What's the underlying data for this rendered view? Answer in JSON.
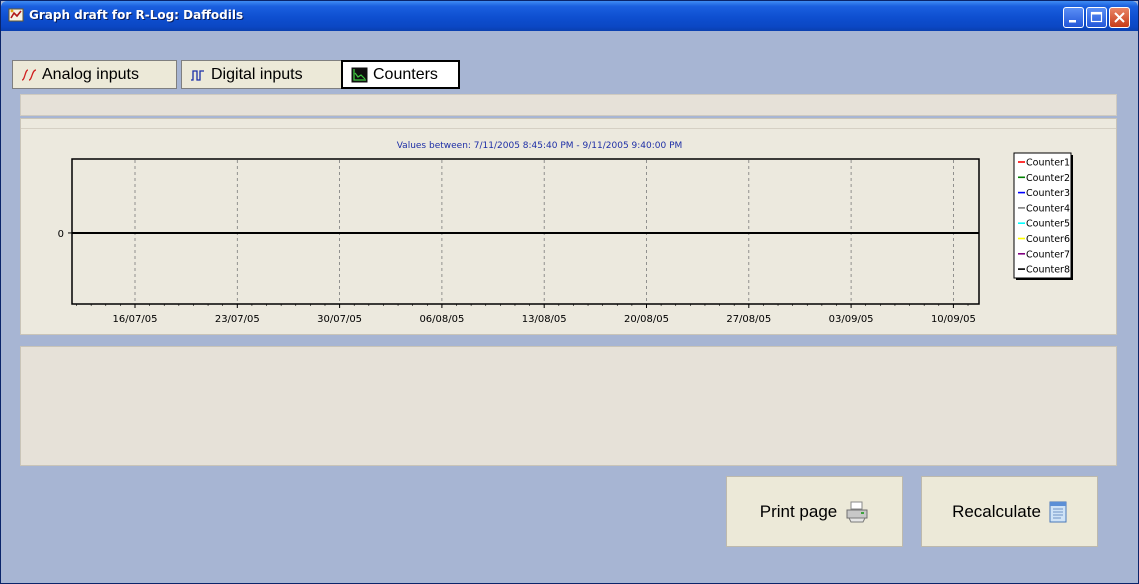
{
  "window": {
    "title": "Graph draft for R-Log: Daffodils",
    "controls": [
      "minimize-icon",
      "maximize-icon",
      "close-icon"
    ]
  },
  "tabs": [
    {
      "label": "Analog inputs",
      "icon": "analog-wave-icon",
      "selected": false
    },
    {
      "label": "Digital inputs",
      "icon": "digital-wave-icon",
      "selected": false
    },
    {
      "label": "Counters",
      "icon": "counter-graph-icon",
      "selected": true
    }
  ],
  "chart": {
    "title": "Values between: 7/11/2005 8:45:40 PM - 9/11/2005 9:40:00 PM",
    "y_tick_label": "0",
    "x_tick_labels": [
      "16/07/05",
      "23/07/05",
      "30/07/05",
      "06/08/05",
      "13/08/05",
      "20/08/05",
      "27/08/05",
      "03/09/05",
      "10/09/05"
    ]
  },
  "chart_data": {
    "type": "line",
    "title": "Values between: 7/11/2005 8:45:40 PM - 9/11/2005 9:40:00 PM",
    "xlabel": "",
    "ylabel": "",
    "x_ticks": [
      "16/07/05",
      "23/07/05",
      "30/07/05",
      "06/08/05",
      "13/08/05",
      "20/08/05",
      "27/08/05",
      "03/09/05",
      "10/09/05"
    ],
    "y_ticks": [
      0
    ],
    "grid": "vertical dashed",
    "legend_position": "right",
    "series": [
      {
        "name": "Counter1",
        "color": "#ff0000",
        "x": [
          "7/11/2005 8:45:40 PM",
          "9/11/2005 9:40:00 PM"
        ],
        "values": [
          0,
          0
        ]
      },
      {
        "name": "Counter2",
        "color": "#008000",
        "x": [
          "7/11/2005 8:45:40 PM",
          "9/11/2005 9:40:00 PM"
        ],
        "values": [
          0,
          0
        ]
      },
      {
        "name": "Counter3",
        "color": "#0000ff",
        "x": [
          "7/11/2005 8:45:40 PM",
          "9/11/2005 9:40:00 PM"
        ],
        "values": [
          0,
          0
        ]
      },
      {
        "name": "Counter4",
        "color": "#808080",
        "x": [
          "7/11/2005 8:45:40 PM",
          "9/11/2005 9:40:00 PM"
        ],
        "values": [
          0,
          0
        ]
      },
      {
        "name": "Counter5",
        "color": "#00ffff",
        "x": [
          "7/11/2005 8:45:40 PM",
          "9/11/2005 9:40:00 PM"
        ],
        "values": [
          0,
          0
        ]
      },
      {
        "name": "Counter6",
        "color": "#ffff00",
        "x": [
          "7/11/2005 8:45:40 PM",
          "9/11/2005 9:40:00 PM"
        ],
        "values": [
          0,
          0
        ]
      },
      {
        "name": "Counter7",
        "color": "#800080",
        "x": [
          "7/11/2005 8:45:40 PM",
          "9/11/2005 9:40:00 PM"
        ],
        "values": [
          0,
          0
        ]
      },
      {
        "name": "Counter8",
        "color": "#000000",
        "x": [
          "7/11/2005 8:45:40 PM",
          "9/11/2005 9:40:00 PM"
        ],
        "values": [
          0,
          0
        ]
      }
    ]
  },
  "buttons": {
    "print": {
      "label": "Print page",
      "icon": "printer-icon"
    },
    "recalculate": {
      "label": "Recalculate",
      "icon": "notepad-icon"
    }
  },
  "colors": {
    "window_background": "#a7b5d3",
    "titlebar": "#0e4fd0",
    "panel": "#ece9de",
    "chart_title": "#1e2fa6"
  }
}
